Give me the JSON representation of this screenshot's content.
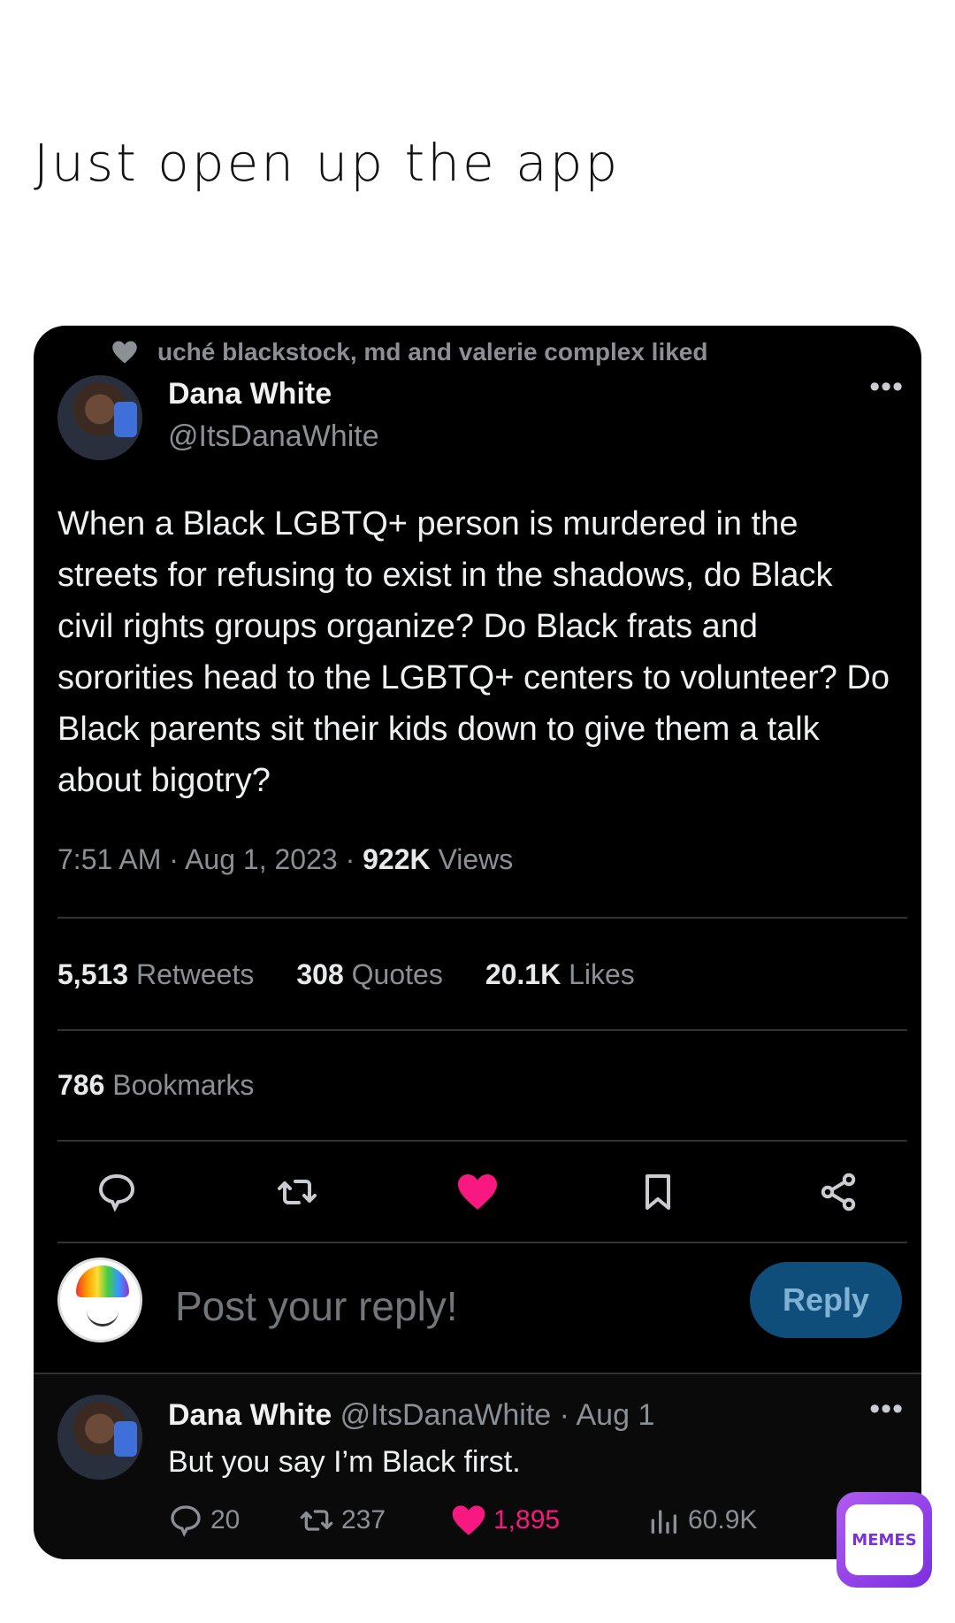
{
  "caption": "Just open up the app",
  "tweet": {
    "liked_by": "uché blackstock, md and valerie complex liked",
    "author_name": "Dana White",
    "author_handle": "@ItsDanaWhite",
    "more": "•••",
    "text": "When a Black LGBTQ+ person is murdered in the streets for refusing to exist in the shadows, do Black civil rights groups organize? Do Black frats and sororities head to the LGBTQ+ centers to volunteer? Do Black parents sit their kids down to give them a talk about bigotry?",
    "timestamp": "7:51 AM · Aug 1, 2023 · ",
    "views_count": "922K",
    "views_label": " Views",
    "retweets_count": "5,513",
    "retweets_label": " Retweets",
    "quotes_count": "308",
    "quotes_label": " Quotes",
    "likes_count": "20.1K",
    "likes_label": " Likes",
    "bookmarks_count": "786",
    "bookmarks_label": " Bookmarks",
    "like_color": "#f91880"
  },
  "reply_box": {
    "placeholder": "Post your reply!",
    "button": "Reply"
  },
  "reply": {
    "author_name": "Dana White",
    "meta": " @ItsDanaWhite · Aug 1",
    "more": "•••",
    "text": "But you say I’m Black first.",
    "comments": "20",
    "retweets": "237",
    "likes": "1,895",
    "views": "60.9K"
  },
  "watermark": "MEMES"
}
